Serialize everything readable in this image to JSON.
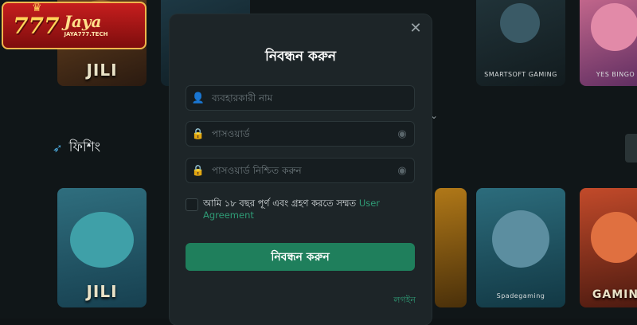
{
  "logo": {
    "number": "777",
    "name": "Jaya",
    "url": "JAYA777.TECH"
  },
  "section": {
    "title": "ফিশিং",
    "icon": "fish-icon"
  },
  "tiles": {
    "top_left_label": "JILI",
    "top_right_provider": "SMARTSOFT GAMING",
    "top_far_right_provider": "YES BINGO",
    "bottom_left_label": "JILI",
    "bottom_mid_provider": "Spadegaming",
    "bottom_right_label": "GAMIN"
  },
  "modal": {
    "title": "নিবন্ধন করুন",
    "username_placeholder": "ব্যবহারকারী নাম",
    "password_placeholder": "পাসওয়ার্ড",
    "confirm_placeholder": "পাসওয়ার্ড নিশ্চিত করুন",
    "agree_text": "আমি ১৮ বছর পূর্ণ এবং গ্রহণ করতে সম্মত",
    "agree_link": "User Agreement",
    "submit_label": "নিবন্ধন করুন",
    "login_link": "লগইন"
  },
  "colors": {
    "accent": "#1f7f5c",
    "link": "#2f9c76",
    "modal_bg": "#1d2528"
  }
}
